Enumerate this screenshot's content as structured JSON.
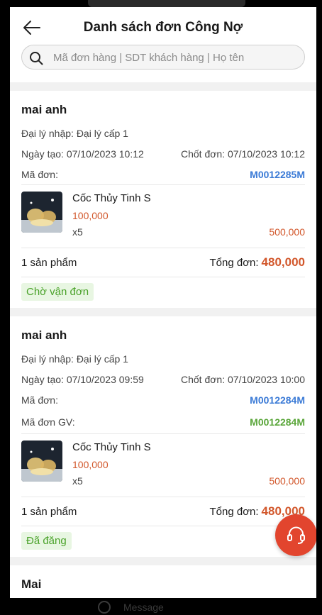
{
  "header": {
    "title": "Danh sách đơn Công Nợ",
    "search_placeholder": "Mã đơn hàng | SDT khách hàng | Họ tên"
  },
  "orders": [
    {
      "customer": "mai anh",
      "agent": "Đại lý nhập: Đại lý cấp 1",
      "created": "Ngày tạo: 07/10/2023 10:12",
      "closed": "Chốt đơn: 07/10/2023 10:12",
      "code_label": "Mã đơn:",
      "code": "M0012285M",
      "product": {
        "name": "Cốc Thủy Tinh S",
        "price": "100,000",
        "qty": "x5",
        "line_total": "500,000"
      },
      "count": "1 sản phẩm",
      "total_label": "Tổng đơn:",
      "total": "480,000",
      "status": "Chờ vận đơn"
    },
    {
      "customer": "mai anh",
      "agent": "Đại lý nhập: Đại lý cấp 1",
      "created": "Ngày tạo: 07/10/2023 09:59",
      "closed": "Chốt đơn: 07/10/2023 10:00",
      "code_label": "Mã đơn:",
      "code": "M0012284M",
      "gv_label": "Mã đơn GV:",
      "gv_code": "M0012284M",
      "product": {
        "name": "Cốc Thủy Tinh S",
        "price": "100,000",
        "qty": "x5",
        "line_total": "500,000"
      },
      "count": "1 sản phẩm",
      "total_label": "Tổng đơn:",
      "total": "480,000",
      "status": "Đã đăng"
    },
    {
      "customer": "Mai"
    }
  ],
  "bottom_bar": {
    "label": "Message"
  },
  "colors": {
    "accent_orange": "#d2572b",
    "code_blue": "#3a7ad6",
    "code_green": "#5aa63a",
    "support": "#e2452e"
  },
  "icons": [
    "back-arrow-icon",
    "search-icon",
    "headset-icon",
    "message-icon"
  ]
}
